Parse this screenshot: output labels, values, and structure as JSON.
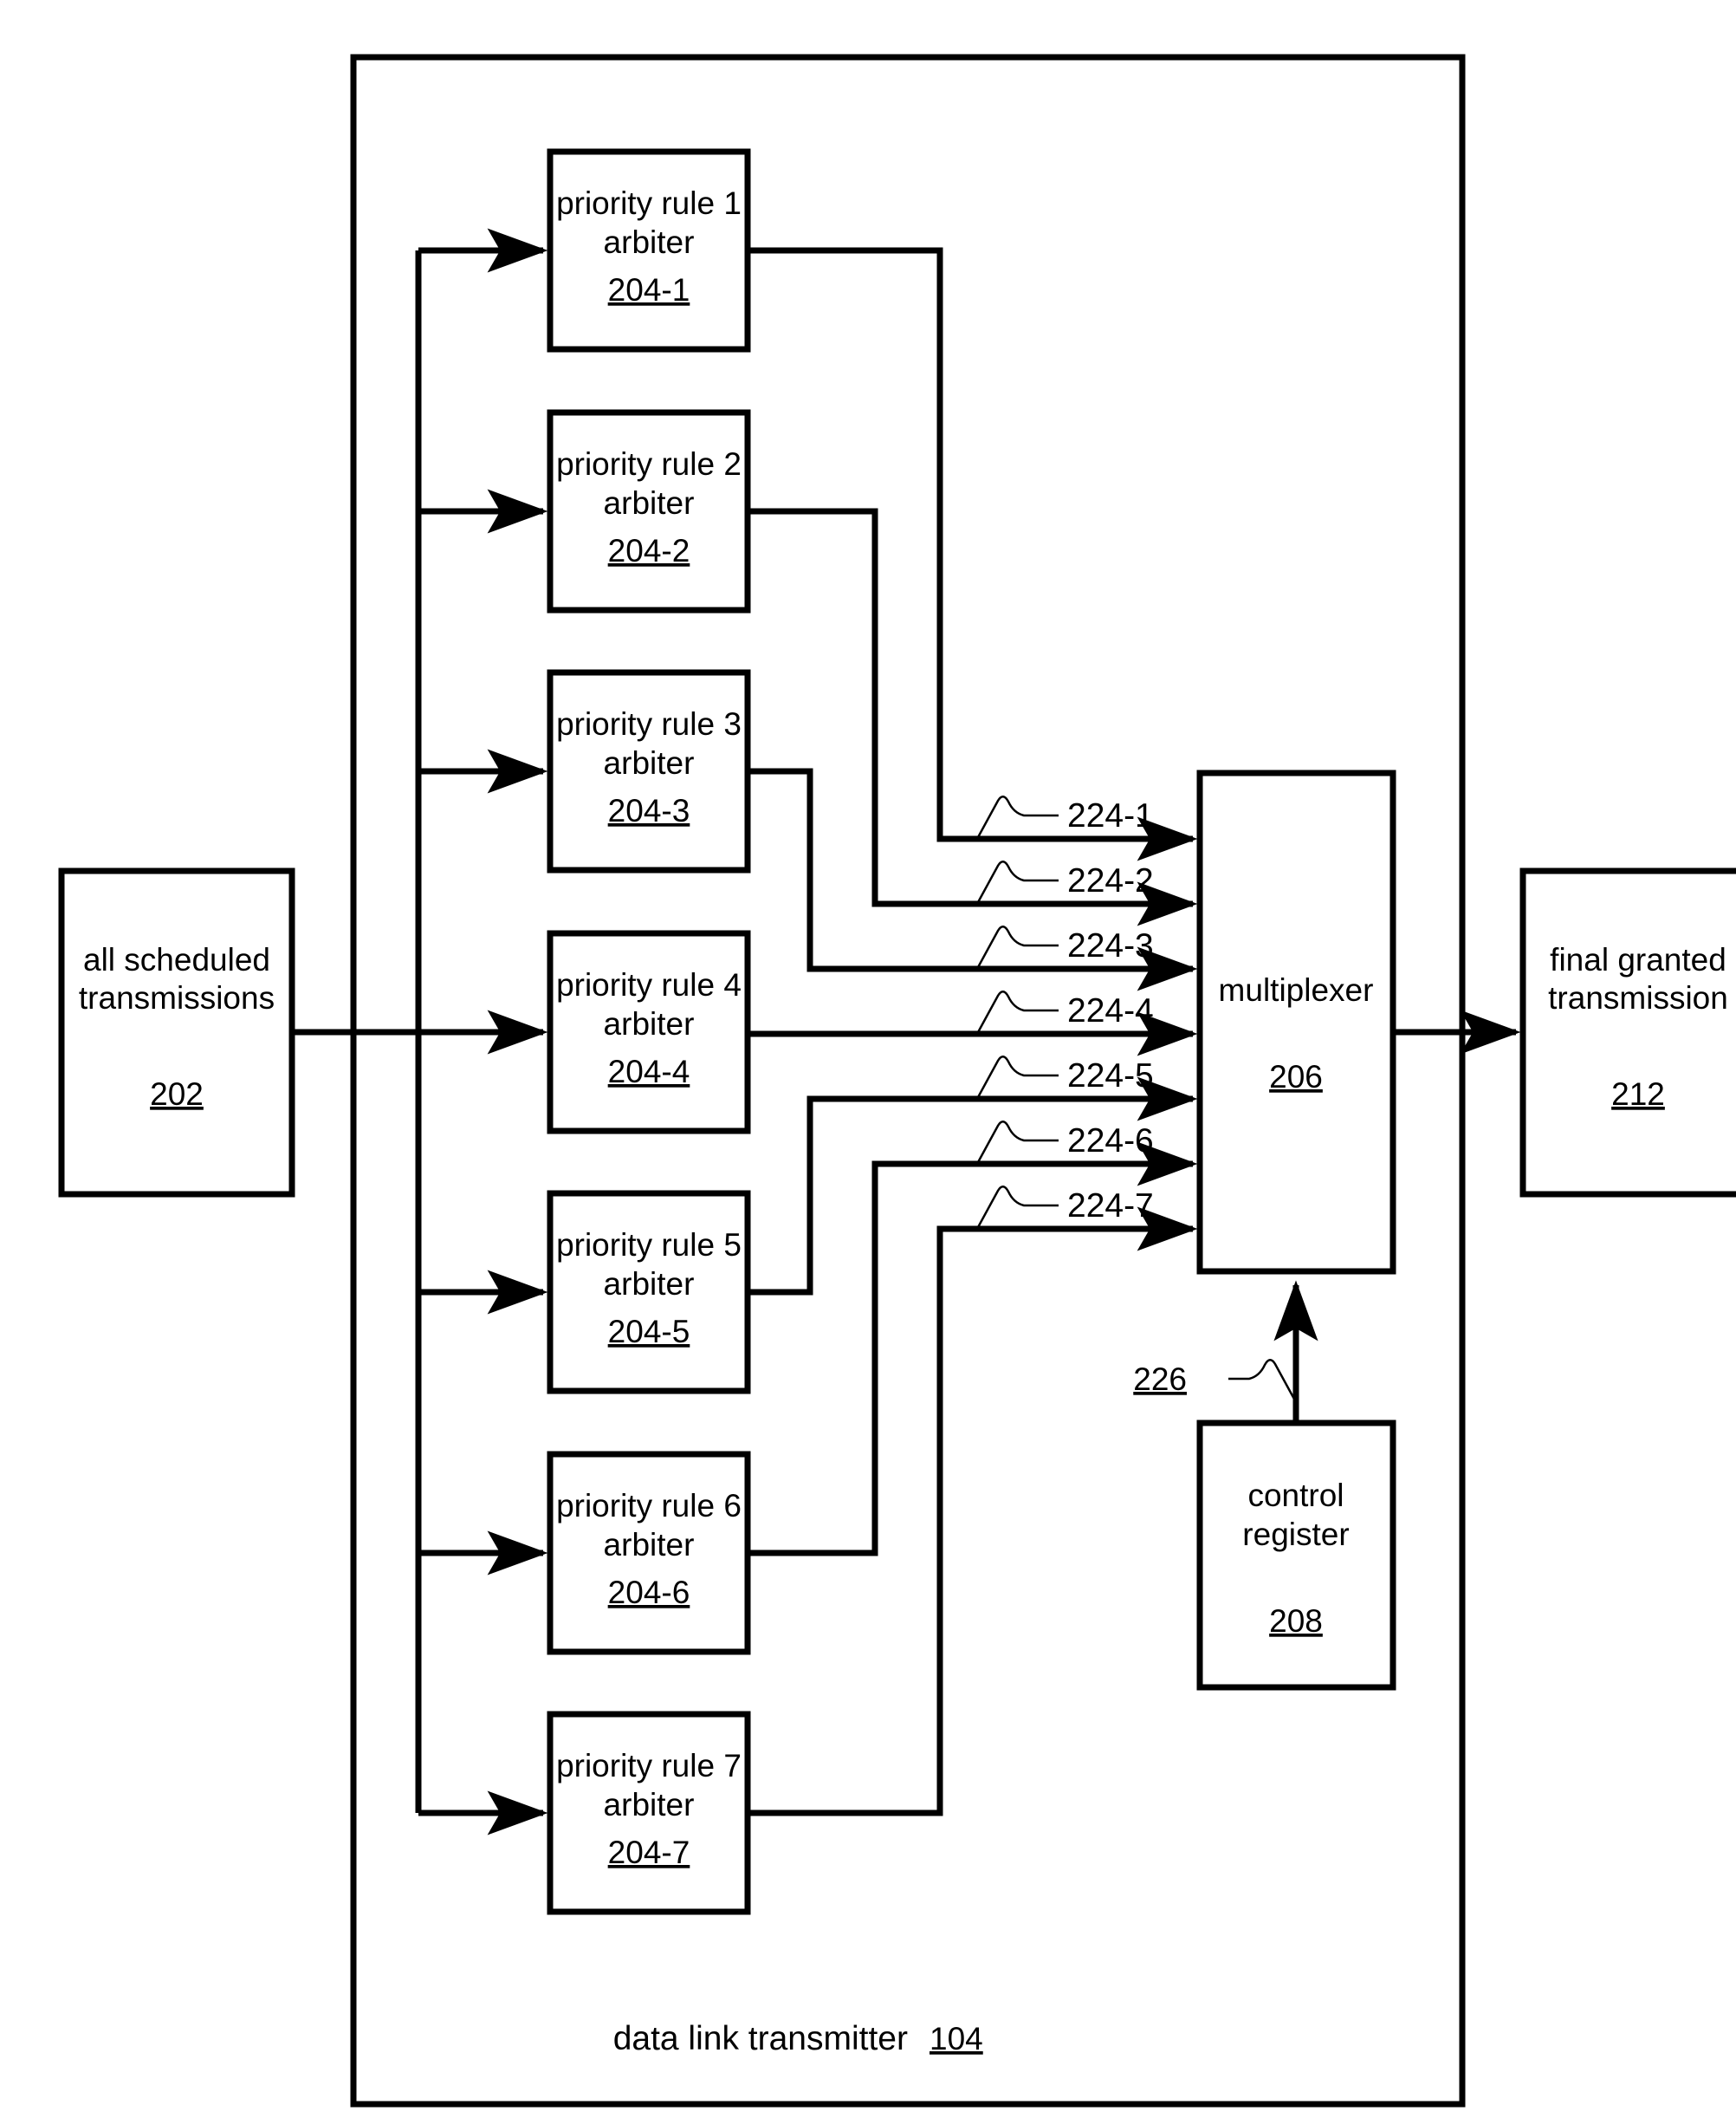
{
  "figure": {
    "container": {
      "caption_label": "data link transmitter",
      "caption_ref": "104"
    },
    "input_block": {
      "line1": "all scheduled",
      "line2": "transmissions",
      "ref": "202"
    },
    "output_block": {
      "line1": "final granted",
      "line2": "transmission",
      "ref": "212"
    },
    "multiplexer": {
      "label": "multiplexer",
      "ref": "206"
    },
    "control_register": {
      "line1": "control",
      "line2": "register",
      "ref": "208"
    },
    "control_signal": {
      "label": "226"
    },
    "arbiters": [
      {
        "line1": "priority rule 1",
        "line2": "arbiter",
        "ref": "204-1"
      },
      {
        "line1": "priority rule 2",
        "line2": "arbiter",
        "ref": "204-2"
      },
      {
        "line1": "priority rule 3",
        "line2": "arbiter",
        "ref": "204-3"
      },
      {
        "line1": "priority rule 4",
        "line2": "arbiter",
        "ref": "204-4"
      },
      {
        "line1": "priority rule 5",
        "line2": "arbiter",
        "ref": "204-5"
      },
      {
        "line1": "priority rule 6",
        "line2": "arbiter",
        "ref": "204-6"
      },
      {
        "line1": "priority rule 7",
        "line2": "arbiter",
        "ref": "204-7"
      }
    ],
    "signals": [
      {
        "label": "224-1"
      },
      {
        "label": "224-2"
      },
      {
        "label": "224-3"
      },
      {
        "label": "224-4"
      },
      {
        "label": "224-5"
      },
      {
        "label": "224-6"
      },
      {
        "label": "224-7"
      }
    ],
    "colors": {
      "ink": "#000000",
      "paper": "#ffffff"
    }
  }
}
